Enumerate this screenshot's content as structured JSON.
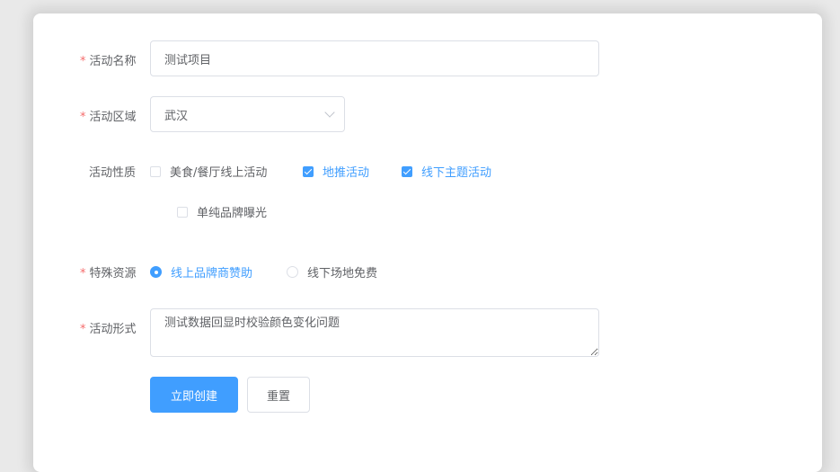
{
  "form": {
    "name": {
      "label": "活动名称",
      "required": true,
      "value": "测试项目"
    },
    "region": {
      "label": "活动区域",
      "required": true,
      "value": "武汉"
    },
    "type": {
      "label": "活动性质",
      "options": [
        {
          "label": "美食/餐厅线上活动",
          "checked": false
        },
        {
          "label": "地推活动",
          "checked": true
        },
        {
          "label": "线下主题活动",
          "checked": true
        },
        {
          "label": "单纯品牌曝光",
          "checked": false
        }
      ]
    },
    "resource": {
      "label": "特殊资源",
      "required": true,
      "options": [
        {
          "label": "线上品牌商赞助",
          "selected": true
        },
        {
          "label": "线下场地免费",
          "selected": false
        }
      ]
    },
    "desc": {
      "label": "活动形式",
      "required": true,
      "value": "测试数据回显时校验颜色变化问题"
    },
    "submit_label": "立即创建",
    "reset_label": "重置",
    "required_mark": "*"
  },
  "colors": {
    "primary": "#409eff",
    "required": "#f56c6c",
    "border": "#dcdfe6",
    "text": "#606266"
  }
}
